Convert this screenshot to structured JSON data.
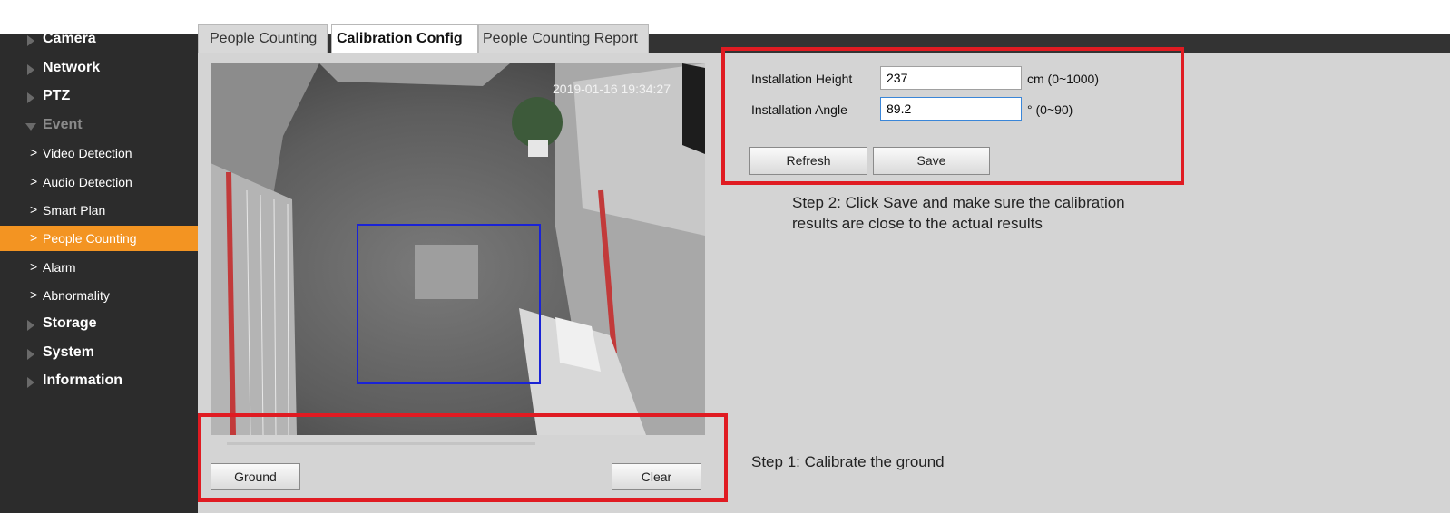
{
  "sidebar": {
    "items": [
      {
        "label": "Camera"
      },
      {
        "label": "Network"
      },
      {
        "label": "PTZ"
      },
      {
        "label": "Event"
      },
      {
        "label": "Storage"
      },
      {
        "label": "System"
      },
      {
        "label": "Information"
      }
    ],
    "event_sub": [
      {
        "label": "Video Detection"
      },
      {
        "label": "Audio Detection"
      },
      {
        "label": "Smart Plan"
      },
      {
        "label": "People Counting",
        "active": true
      },
      {
        "label": "Alarm"
      },
      {
        "label": "Abnormality"
      }
    ],
    "chevron": ">"
  },
  "tabs": [
    {
      "label": "People Counting"
    },
    {
      "label": "Calibration Config",
      "active": true
    },
    {
      "label": "People Counting Report"
    }
  ],
  "video": {
    "timestamp": "2019-01-16 19:34:27"
  },
  "buttons": {
    "ground": "Ground",
    "clear": "Clear",
    "refresh": "Refresh",
    "save": "Save"
  },
  "form": {
    "height_label": "Installation Height",
    "height_value": "237",
    "height_unit": "cm (0~1000)",
    "angle_label": "Installation Angle",
    "angle_value": "89.2",
    "angle_unit": "° (0~90)"
  },
  "steps": {
    "step1": "Step 1: Calibrate the ground",
    "step2_line1": "Step 2: Click Save and make sure the calibration",
    "step2_line2": "results are close to the actual results"
  },
  "colors": {
    "active_orange": "#f39422",
    "annotation_red": "#e01b22",
    "calibration_box_blue": "#1a23d6"
  }
}
